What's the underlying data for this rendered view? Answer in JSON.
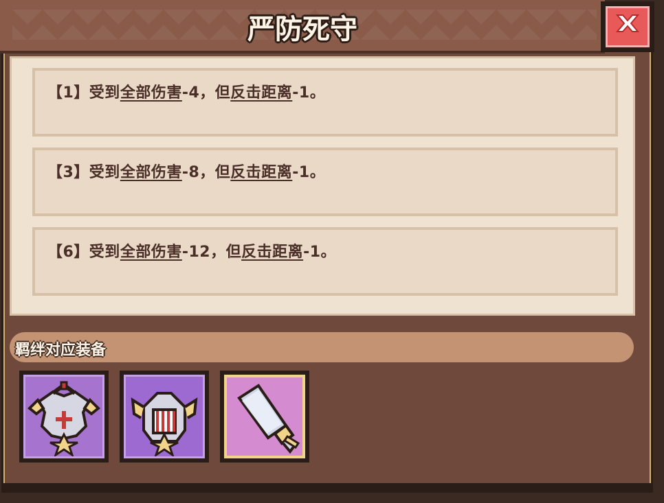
{
  "dialog": {
    "title": "严防死守",
    "close_icon": "close-x-icon"
  },
  "entries": [
    {
      "prefix": "【1】受到",
      "l1": "全部伤害",
      "mid": "-4，但",
      "l2": "反击距离",
      "suffix": "-1。"
    },
    {
      "prefix": "【3】受到",
      "l1": "全部伤害",
      "mid": "-8，但",
      "l2": "反击距离",
      "suffix": "-1。"
    },
    {
      "prefix": "【6】受到",
      "l1": "全部伤害",
      "mid": "-12，但",
      "l2": "反击距离",
      "suffix": "-1。"
    }
  ],
  "section": {
    "title": "羁绊对应装备"
  },
  "equipment": [
    {
      "name": "armor-item",
      "icon": "armor-icon",
      "rarity": "purple"
    },
    {
      "name": "helmet-item",
      "icon": "helmet-icon",
      "rarity": "purple"
    },
    {
      "name": "sword-item",
      "icon": "sword-icon",
      "rarity": "pink"
    }
  ],
  "colors": {
    "frame": "#6f4a3c",
    "panel": "#efe2d1",
    "entry": "#ead9c7",
    "text": "#4a2f28",
    "close": "#e85a5a"
  }
}
